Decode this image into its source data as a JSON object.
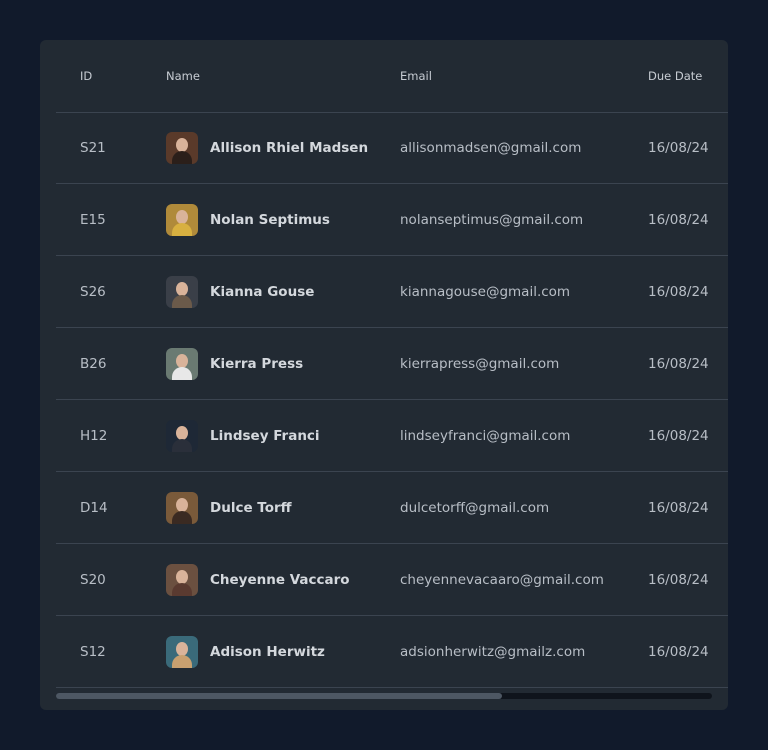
{
  "table": {
    "headers": {
      "id": "ID",
      "name": "Name",
      "email": "Email",
      "due_date": "Due Date"
    },
    "rows": [
      {
        "id": "S21",
        "name": "Allison Rhiel Madsen",
        "email": "allisonmadsen@gmail.com",
        "due_date": "16/08/24"
      },
      {
        "id": "E15",
        "name": "Nolan Septimus",
        "email": "nolanseptimus@gmail.com",
        "due_date": "16/08/24"
      },
      {
        "id": "S26",
        "name": "Kianna Gouse",
        "email": "kiannagouse@gmail.com",
        "due_date": "16/08/24"
      },
      {
        "id": "B26",
        "name": "Kierra Press",
        "email": "kierrapress@gmail.com",
        "due_date": "16/08/24"
      },
      {
        "id": "H12",
        "name": "Lindsey Franci",
        "email": "lindseyfranci@gmail.com",
        "due_date": "16/08/24"
      },
      {
        "id": "D14",
        "name": "Dulce Torff",
        "email": "dulcetorff@gmail.com",
        "due_date": "16/08/24"
      },
      {
        "id": "S20",
        "name": "Cheyenne Vaccaro",
        "email": "cheyennevacaaro@gmail.com",
        "due_date": "16/08/24"
      },
      {
        "id": "S12",
        "name": "Adison Herwitz",
        "email": "adsionherwitz@gmailz.com",
        "due_date": "16/08/24"
      }
    ]
  },
  "avatar_colors": [
    {
      "bg": "#5a3a2a",
      "body": "#2b1f1a"
    },
    {
      "bg": "#b08a3a",
      "body": "#d8b040"
    },
    {
      "bg": "#3a3f48",
      "body": "#6b5a4a"
    },
    {
      "bg": "#6a7a72",
      "body": "#e8e8e8"
    },
    {
      "bg": "#1e2836",
      "body": "#2a2f3a"
    },
    {
      "bg": "#7a5a3a",
      "body": "#3a2a22"
    },
    {
      "bg": "#6b5040",
      "body": "#5a3a30"
    },
    {
      "bg": "#3a6a7a",
      "body": "#c8a070"
    }
  ],
  "scrollbar": {
    "thumb_fraction": 0.68
  }
}
